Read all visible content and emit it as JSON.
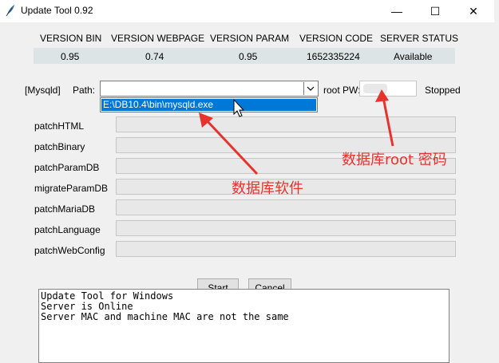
{
  "window": {
    "title": "Update Tool 0.92",
    "min_glyph": "—",
    "max_glyph": "☐",
    "close_glyph": "✕"
  },
  "versions": {
    "headers": [
      "VERSION BIN",
      "VERSION WEBPAGE",
      "VERSION PARAM",
      "VERSION CODE",
      "SERVER STATUS"
    ],
    "values": [
      "0.95",
      "0.74",
      "0.95",
      "1652335224",
      "Available"
    ]
  },
  "mysql": {
    "section_label": "[Mysqld]",
    "path_label": "Path:",
    "path_value": "",
    "dropdown_option": "E:\\DB10.4\\bin\\mysqld.exe",
    "root_pw_label": "root PW:",
    "status": "Stopped"
  },
  "patches": [
    "patchHTML",
    "patchBinary",
    "patchParamDB",
    "migrateParamDB",
    "patchMariaDB",
    "patchLanguage",
    "patchWebConfig"
  ],
  "buttons": {
    "start": "Start",
    "cancel": "Cancel"
  },
  "log": {
    "lines": [
      "Update Tool for Windows",
      "Server is Online",
      "Server MAC and machine MAC are not the same"
    ]
  },
  "annotations": {
    "password_note": "数据库root 密码",
    "software_note": "数据库软件",
    "color": "#e8322c"
  },
  "colors": {
    "selection": "#0078d7",
    "version_strip": "#dde4e5",
    "window_bg": "#f0f0f0"
  }
}
